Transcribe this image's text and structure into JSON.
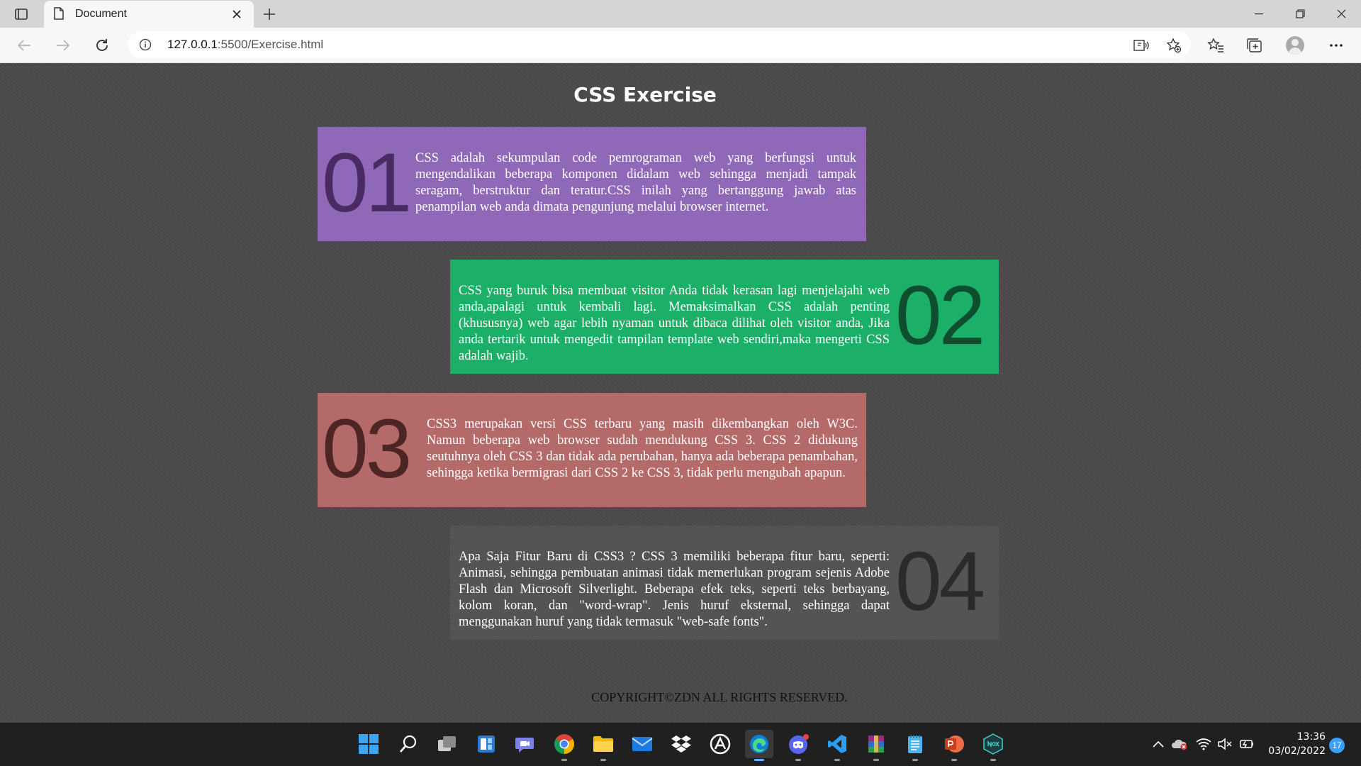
{
  "browser": {
    "tab_title": "Document",
    "url_host": "127.0.0.1",
    "url_path": ":5500/Exercise.html"
  },
  "page": {
    "title": "CSS Exercise",
    "cards": [
      {
        "number": "01",
        "bg": "#9068b8",
        "num_color": "#4a2a63",
        "text": "CSS adalah sekumpulan code pemrograman web yang berfungsi untuk mengendalikan beberapa komponen didalam web sehingga menjadi tampak seragam, berstruktur dan teratur.CSS inilah yang bertanggung jawab atas penampilan web anda dimata pengunjung melalui browser internet."
      },
      {
        "number": "02",
        "bg": "#1caf68",
        "num_color": "#0d4e2f",
        "text": "CSS yang buruk bisa membuat visitor Anda tidak kerasan lagi menjelajahi web anda,apalagi untuk kembali lagi. Memaksimalkan CSS adalah penting (khususnya) web agar lebih nyaman untuk dibaca dilihat oleh visitor anda, Jika anda tertarik untuk mengedit tampilan template web sendiri,maka mengerti CSS adalah wajib."
      },
      {
        "number": "03",
        "bg": "#b56a6a",
        "num_color": "#4d2525",
        "text": "CSS3 merupakan versi CSS terbaru yang masih dikembangkan oleh W3C. Namun beberapa web browser sudah mendukung CSS 3. CSS 2 didukung seutuhnya oleh CSS 3 dan tidak ada perubahan, hanya ada beberapa penambahan, sehingga ketika bermigrasi dari CSS 2 ke CSS 3, tidak perlu mengubah apapun."
      },
      {
        "number": "04",
        "bg": "#545454",
        "num_color": "#2b2b2b",
        "text": "Apa Saja Fitur Baru di CSS3 ? CSS 3 memiliki beberapa fitur baru, seperti: Animasi, sehingga pembuatan animasi tidak memerlukan program sejenis Adobe Flash dan Microsoft Silverlight. Beberapa efek teks, seperti teks berbayang, kolom koran, dan \"word-wrap\". Jenis huruf eksternal, sehingga dapat menggunakan huruf yang tidak termasuk \"web-safe fonts\"."
      }
    ],
    "copyright": "COPYRIGHT©ZDN ALL RIGHTS RESERVED."
  },
  "taskbar": {
    "time": "13:36",
    "date": "03/02/2022",
    "notifications": "17"
  }
}
